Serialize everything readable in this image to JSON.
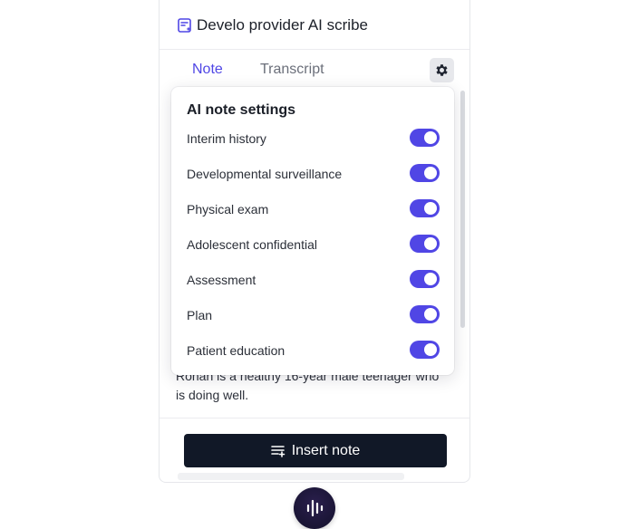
{
  "header": {
    "title": "Develo provider AI scribe"
  },
  "tabs": [
    {
      "label": "Note",
      "active": true
    },
    {
      "label": "Transcript",
      "active": false
    }
  ],
  "note": {
    "summary_line1": "Ronan is a healthy 16-year male teenager who",
    "summary_line2": "is doing well."
  },
  "settings_menu": {
    "title": "AI note settings",
    "items": [
      {
        "label": "Interim history",
        "enabled": true
      },
      {
        "label": "Developmental surveillance",
        "enabled": true
      },
      {
        "label": "Physical exam",
        "enabled": true
      },
      {
        "label": "Adolescent confidential",
        "enabled": true
      },
      {
        "label": "Assessment",
        "enabled": true
      },
      {
        "label": "Plan",
        "enabled": true
      },
      {
        "label": "Patient education",
        "enabled": true
      }
    ]
  },
  "footer": {
    "insert_label": "Insert note"
  },
  "icons": {
    "logo": "note-sparkle-icon",
    "settings": "gear-icon",
    "insert": "list-plus-icon",
    "record": "waveform-icon"
  },
  "colors": {
    "accent": "#4f46e5",
    "toggle_on": "#5046e5",
    "button_dark": "#111827"
  }
}
